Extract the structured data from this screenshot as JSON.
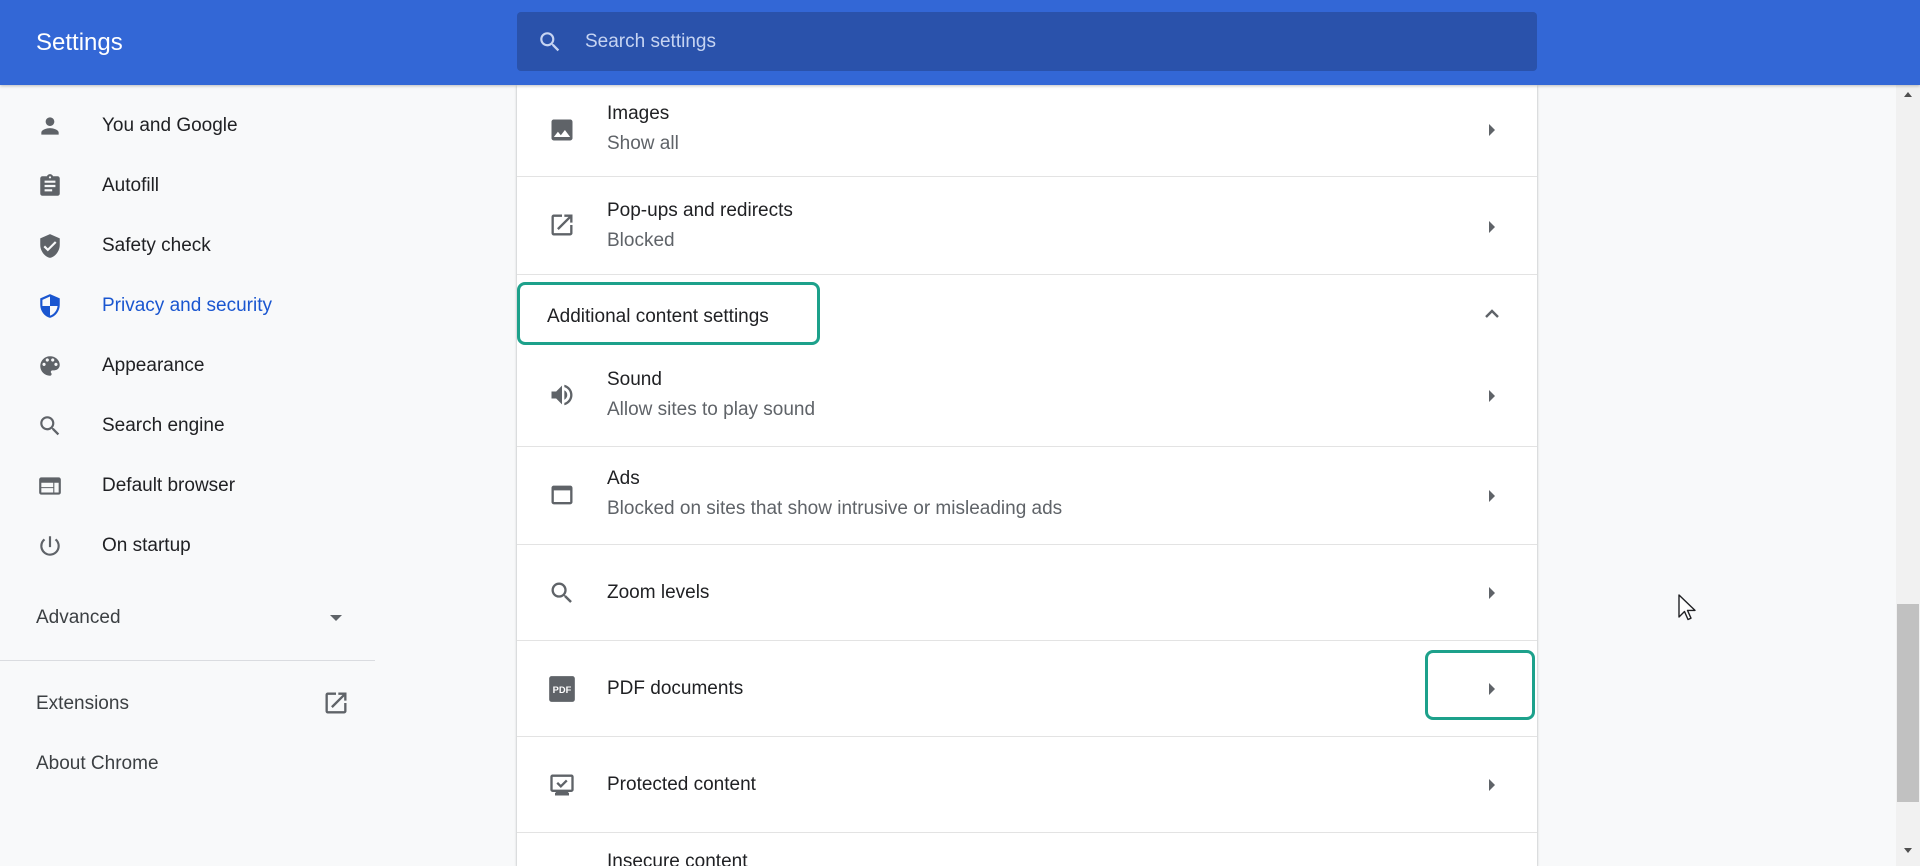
{
  "header": {
    "title": "Settings",
    "search_placeholder": "Search settings"
  },
  "sidebar": {
    "items": [
      {
        "label": "You and Google",
        "icon": "person-icon"
      },
      {
        "label": "Autofill",
        "icon": "clipboard-icon"
      },
      {
        "label": "Safety check",
        "icon": "shield-check-icon"
      },
      {
        "label": "Privacy and security",
        "icon": "shield-half-icon",
        "active": true
      },
      {
        "label": "Appearance",
        "icon": "palette-icon"
      },
      {
        "label": "Search engine",
        "icon": "search-icon"
      },
      {
        "label": "Default browser",
        "icon": "browser-window-icon"
      },
      {
        "label": "On startup",
        "icon": "power-icon"
      }
    ],
    "advanced_label": "Advanced",
    "extensions_label": "Extensions",
    "about_label": "About Chrome"
  },
  "content": {
    "images": {
      "title": "Images",
      "subtitle": "Show all"
    },
    "popups": {
      "title": "Pop-ups and redirects",
      "subtitle": "Blocked"
    },
    "section_title": "Additional content settings",
    "sound": {
      "title": "Sound",
      "subtitle": "Allow sites to play sound"
    },
    "ads": {
      "title": "Ads",
      "subtitle": "Blocked on sites that show intrusive or misleading ads"
    },
    "zoom": {
      "title": "Zoom levels"
    },
    "pdf": {
      "title": "PDF documents",
      "icon_text": "PDF"
    },
    "protected": {
      "title": "Protected content"
    },
    "insecure": {
      "title": "Insecure content"
    }
  },
  "colors": {
    "header_bg": "#3367d6",
    "search_bg": "#2a52ab",
    "active_nav": "#1a56d0",
    "highlight": "#1da18b"
  }
}
